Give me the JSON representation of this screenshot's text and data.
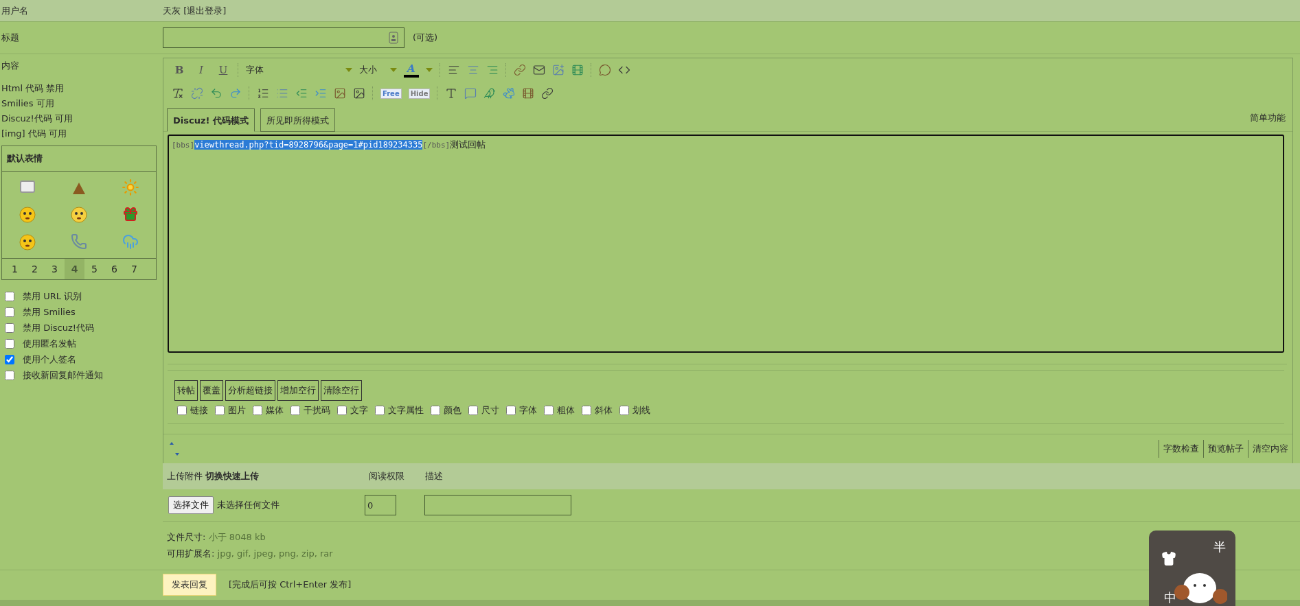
{
  "user_row": {
    "label": "用户名",
    "value": "天灰 [退出登录]"
  },
  "title_row": {
    "label": "标题",
    "hint": "(可选)"
  },
  "content": {
    "label": "内容",
    "status": [
      "Html 代码 禁用",
      "Smilies 可用",
      "Discuz!代码 可用",
      "[img] 代码 可用"
    ]
  },
  "smilies": {
    "title": "默认表情",
    "pages": [
      {
        "label": "1",
        "selected": false
      },
      {
        "label": "2",
        "selected": false
      },
      {
        "label": "3",
        "selected": false
      },
      {
        "label": "4",
        "selected": true
      },
      {
        "label": "5",
        "selected": false
      },
      {
        "label": "6",
        "selected": false
      },
      {
        "label": "7",
        "selected": false
      }
    ]
  },
  "options": [
    {
      "label": "禁用 URL 识别",
      "checked": false
    },
    {
      "label": "禁用 Smilies",
      "checked": false
    },
    {
      "label": "禁用 Discuz!代码",
      "checked": false
    },
    {
      "label": "使用匿名发帖",
      "checked": false
    },
    {
      "label": "使用个人签名",
      "checked": true
    },
    {
      "label": "接收新回复邮件通知",
      "checked": false
    }
  ],
  "toolbar": {
    "format_buttons": [
      "B",
      "I",
      "U"
    ],
    "font_select": "字体",
    "size_select": "大小",
    "color_button": "A",
    "badge_icons": [
      "Free",
      "Hide"
    ]
  },
  "editor_tabs": [
    {
      "label": "Discuz! 代码模式",
      "selected": true
    },
    {
      "label": "所见即所得模式",
      "selected": false
    }
  ],
  "simple_mode_link": "简单功能",
  "editor_text": {
    "open_tag": "[bbs]",
    "selected": "viewthread.php?tid=8928796&page=1#pid189234335",
    "close_tag": "[/bbs]",
    "after": "测试回帖"
  },
  "tool_buttons": [
    "转帖",
    "覆盖",
    "分析超链接",
    "增加空行",
    "清除空行"
  ],
  "filters": [
    {
      "label": "链接",
      "checked": false
    },
    {
      "label": "图片",
      "checked": false
    },
    {
      "label": "媒体",
      "checked": false
    },
    {
      "label": "干扰码",
      "checked": false
    },
    {
      "label": "文字",
      "checked": false
    },
    {
      "label": "文字属性",
      "checked": false
    },
    {
      "label": "颜色",
      "checked": false
    },
    {
      "label": "尺寸",
      "checked": false
    },
    {
      "label": "字体",
      "checked": false
    },
    {
      "label": "粗体",
      "checked": false
    },
    {
      "label": "斜体",
      "checked": false
    },
    {
      "label": "划线",
      "checked": false
    }
  ],
  "footer_buttons": [
    "字数检查",
    "预览帖子",
    "清空内容"
  ],
  "attachments": {
    "header_label": "上传附件",
    "toggle_link": "切换快速上传",
    "permission_header": "阅读权限",
    "description_header": "描述",
    "file_button": "选择文件",
    "file_status": "未选择任何文件",
    "permission_value": "0",
    "size_label": "文件尺寸:",
    "size_value": "小于 8048 kb",
    "ext_label": "可用扩展名:",
    "ext_value": "jpg, gif, jpeg, png, zip, rar"
  },
  "submit": {
    "button": "发表回复",
    "hint": "[完成后可按 Ctrl+Enter 发布]"
  },
  "ime_widget": {
    "chars": [
      "半",
      "中"
    ]
  }
}
